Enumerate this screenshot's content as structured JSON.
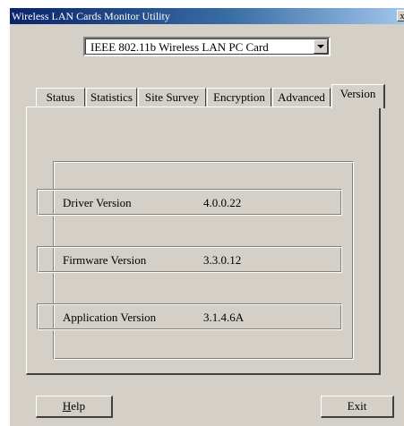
{
  "window": {
    "title": "Wireless LAN Cards Monitor Utility",
    "close_glyph": "x"
  },
  "adapter_select": {
    "selected": "IEEE 802.11b Wireless LAN PC Card"
  },
  "tabs": [
    {
      "label": "Status",
      "active": false
    },
    {
      "label": "Statistics",
      "active": false
    },
    {
      "label": "Site Survey",
      "active": false
    },
    {
      "label": "Encryption",
      "active": false
    },
    {
      "label": "Advanced",
      "active": false
    },
    {
      "label": "Version",
      "active": true
    }
  ],
  "version_info": {
    "driver": {
      "label": "Driver Version",
      "value": "4.0.0.22"
    },
    "firmware": {
      "label": "Firmware Version",
      "value": "3.3.0.12"
    },
    "application": {
      "label": "Application Version",
      "value": "3.1.4.6A"
    }
  },
  "buttons": {
    "help": {
      "mnemonic": "H",
      "rest": "elp"
    },
    "exit": {
      "label": "Exit"
    }
  },
  "colors": {
    "face": "#d4d0c8",
    "titlebar_start": "#0a246a",
    "titlebar_end": "#a6caf0"
  }
}
